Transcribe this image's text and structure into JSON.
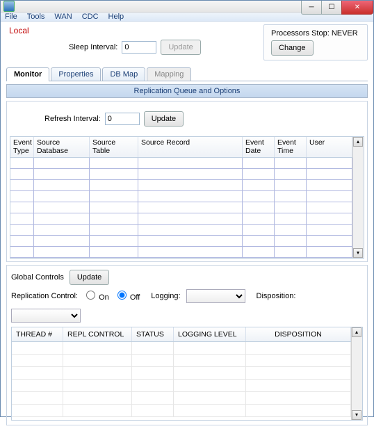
{
  "menubar": {
    "file": "File",
    "tools": "Tools",
    "wan": "WAN",
    "cdc": "CDC",
    "help": "Help"
  },
  "top": {
    "local_label": "Local",
    "sleep_label": "Sleep Interval:",
    "sleep_value": "0",
    "update_btn": "Update",
    "proc_label": "Processors Stop: NEVER",
    "change_btn": "Change"
  },
  "tabs": {
    "monitor": "Monitor",
    "properties": "Properties",
    "dbmap": "DB Map",
    "mapping": "Mapping"
  },
  "section": {
    "title": "Replication Queue and Options"
  },
  "refresh": {
    "label": "Refresh Interval:",
    "value": "0",
    "btn": "Update"
  },
  "queue_cols": {
    "event_type": "Event Type",
    "src_db": "Source Database",
    "src_table": "Source Table",
    "src_rec": "Source Record",
    "evt_date": "Event Date",
    "evt_time": "Event Time",
    "user": "User"
  },
  "globals": {
    "label": "Global Controls",
    "update": "Update",
    "repl_label": "Replication Control:",
    "on": "On",
    "off": "Off",
    "logging": "Logging:",
    "disposition": "Disposition:"
  },
  "thread_cols": {
    "thread": "THREAD #",
    "repl": "REPL CONTROL",
    "status": "STATUS",
    "loglevel": "LOGGING LEVEL",
    "disp": "DISPOSITION"
  }
}
